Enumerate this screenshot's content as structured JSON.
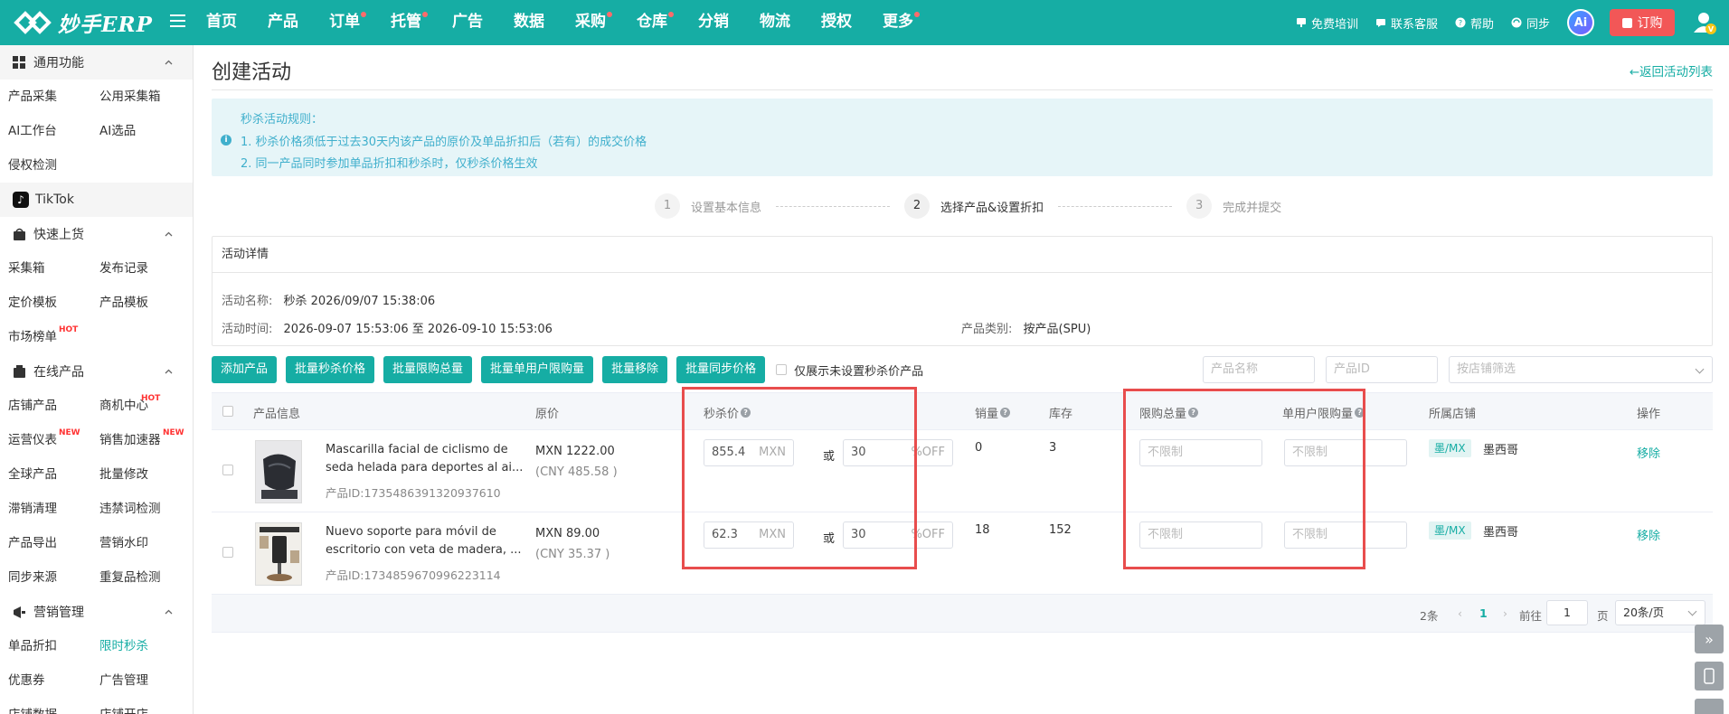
{
  "app": {
    "logo_text": "妙手ERP",
    "nav": [
      {
        "label": "首页",
        "dot": false
      },
      {
        "label": "产品",
        "dot": false
      },
      {
        "label": "订单",
        "dot": true
      },
      {
        "label": "托管",
        "dot": true
      },
      {
        "label": "广告",
        "dot": false
      },
      {
        "label": "数据",
        "dot": false
      },
      {
        "label": "采购",
        "dot": true
      },
      {
        "label": "仓库",
        "dot": true
      },
      {
        "label": "分销",
        "dot": false
      },
      {
        "label": "物流",
        "dot": false
      },
      {
        "label": "授权",
        "dot": false
      },
      {
        "label": "更多",
        "dot": true
      }
    ],
    "right": {
      "training": "免费培训",
      "support": "联系客服",
      "help": "帮助",
      "sync": "同步",
      "ai": "Ai",
      "order": "订购"
    },
    "colors": {
      "primary": "#16ada4",
      "danger": "#f25757",
      "highlight": "#e84d4d",
      "notice_bg": "#e6f5f8",
      "notice_text": "#3fafcc"
    }
  },
  "sidebar": {
    "common": {
      "title": "通用功能",
      "items": [
        "产品采集",
        "公用采集箱",
        "AI工作台",
        "AI选品",
        "侵权检测"
      ]
    },
    "platform": "TikTok",
    "quick": {
      "title": "快速上货",
      "items": [
        "采集箱",
        "发布记录",
        "定价模板",
        "产品模板",
        "市场榜单"
      ],
      "hot_tag": "HOT"
    },
    "online": {
      "title": "在线产品",
      "items": [
        "店铺产品",
        "商机中心",
        "运营仪表",
        "销售加速器",
        "全球产品",
        "批量修改",
        "滞销清理",
        "违禁词检测",
        "产品导出",
        "营销水印",
        "同步来源",
        "重复品检测"
      ],
      "hot_tag": "HOT",
      "new_tag": "NEW"
    },
    "marketing": {
      "title": "营销管理",
      "items": [
        "单品折扣",
        "限时秒杀",
        "优惠券",
        "广告管理",
        "店铺数据",
        "店铺开店"
      ]
    }
  },
  "page": {
    "title": "创建活动",
    "back": "←返回活动列表",
    "notice": {
      "title": "秒杀活动规则：",
      "line1": "1. 秒杀价格须低于过去30天内该产品的原价及单品折扣后（若有）的成交价格",
      "line2": "2. 同一产品同时参加单品折扣和秒杀时，仅秒杀价格生效"
    },
    "steps": [
      {
        "num": "1",
        "label": "设置基本信息"
      },
      {
        "num": "2",
        "label": "选择产品&设置折扣"
      },
      {
        "num": "3",
        "label": "完成并提交"
      }
    ],
    "detail": {
      "header": "活动详情",
      "name_label": "活动名称:",
      "name_value": "秒杀 2026/09/07 15:38:06",
      "time_label": "活动时间:",
      "time_value": "2026-09-07 15:53:06 至 2026-09-10 15:53:06",
      "type_label": "产品类别:",
      "type_value": "按产品(SPU)"
    },
    "toolbar": {
      "buttons": [
        "添加产品",
        "批量秒杀价格",
        "批量限购总量",
        "批量单用户限购量",
        "批量移除",
        "批量同步价格"
      ],
      "only_unset": "仅展示未设置秒杀价产品",
      "name_placeholder": "产品名称",
      "id_placeholder": "产品ID",
      "store_placeholder": "按店铺筛选"
    },
    "table": {
      "headers": {
        "product": "产品信息",
        "price": "原价",
        "flash": "秒杀价",
        "sales": "销量",
        "stock": "库存",
        "total_limit": "限购总量",
        "user_limit": "单用户限购量",
        "store": "所属店铺",
        "action": "操作"
      },
      "rows": [
        {
          "title": "Mascarilla facial de ciclismo de seda helada para deportes al ai...",
          "id": "产品ID:1735486391320937610",
          "price": "MXN 1222.00",
          "cny": "(CNY 485.58 )",
          "flash_price": "855.4",
          "currency": "MXN",
          "or": "或",
          "discount": "30",
          "discount_suffix": "%OFF",
          "sales": "0",
          "stock": "3",
          "limit_placeholder": "不限制",
          "store_tag": "墨/MX",
          "store_name": "墨西哥",
          "action": "移除"
        },
        {
          "title": "Nuevo soporte para móvil de escritorio con veta de madera, ...",
          "id": "产品ID:1734859670996223114",
          "price": "MXN 89.00",
          "cny": "(CNY 35.37 )",
          "flash_price": "62.3",
          "currency": "MXN",
          "or": "或",
          "discount": "30",
          "discount_suffix": "%OFF",
          "sales": "18",
          "stock": "152",
          "limit_placeholder": "不限制",
          "store_tag": "墨/MX",
          "store_name": "墨西哥",
          "action": "移除"
        }
      ]
    },
    "pager": {
      "total": "2条",
      "current": "1",
      "goto": "前往",
      "page_value": "1",
      "page_unit": "页",
      "size": "20条/页"
    }
  }
}
